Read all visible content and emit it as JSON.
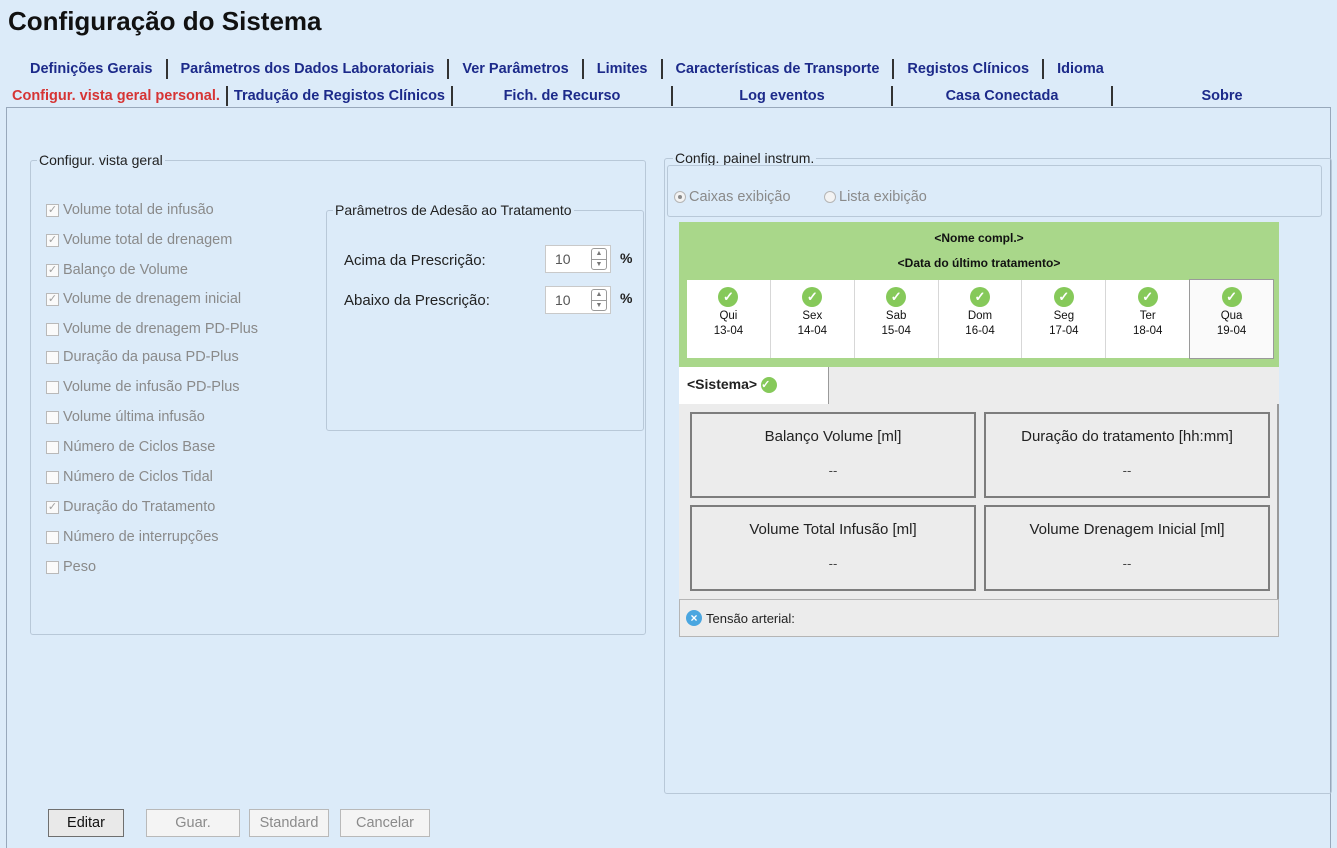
{
  "title": "Configuração do Sistema",
  "tabs_row1": [
    "Definições Gerais",
    "Parâmetros dos Dados Laboratoriais",
    "Ver Parâmetros",
    "Limites",
    "Características de Transporte",
    "Registos Clínicos",
    "Idioma"
  ],
  "tabs_row2": [
    "Configur. vista geral personal.",
    "Tradução de Registos Clínicos",
    "Fich. de Recurso",
    "Log eventos",
    "Casa Conectada",
    "Sobre"
  ],
  "active_tab": "Configur. vista geral personal.",
  "colors": {
    "active_tab": "#d63434",
    "tab_text": "#1c2a8a",
    "background": "#dcebf9",
    "preview_green": "#a9d78a",
    "check_green": "#86c95a"
  },
  "overview": {
    "legend": "Configur. vista geral",
    "items": [
      {
        "label": "Volume total de infusão",
        "checked": true
      },
      {
        "label": "Volume total de drenagem",
        "checked": true
      },
      {
        "label": "Balanço de Volume",
        "checked": true
      },
      {
        "label": "Volume de drenagem inicial",
        "checked": true
      },
      {
        "label": "Volume de drenagem PD-Plus",
        "checked": false
      },
      {
        "label": "Duração da pausa PD-Plus",
        "checked": false
      },
      {
        "label": "Volume de infusão PD-Plus",
        "checked": false
      },
      {
        "label": "Volume última infusão",
        "checked": false
      },
      {
        "label": "Número de Ciclos Base",
        "checked": false
      },
      {
        "label": "Número de Ciclos Tidal",
        "checked": false
      },
      {
        "label": "Duração do Tratamento",
        "checked": true
      },
      {
        "label": "Número de interrupções",
        "checked": false
      },
      {
        "label": "Peso",
        "checked": false
      }
    ]
  },
  "adherence": {
    "legend": "Parâmetros de Adesão ao Tratamento",
    "above_label": "Acima da Prescrição:",
    "above_value": "10",
    "below_label": "Abaixo da Prescrição:",
    "below_value": "10",
    "unit": "%"
  },
  "dashboard": {
    "legend": "Config. painel instrum.",
    "radio_boxes": "Caixas exibição",
    "radio_list": "Lista exibição",
    "selected": "Caixas exibição",
    "name": "<Nome compl.>",
    "last_treatment": "<Data do último tratamento>",
    "days": [
      {
        "day": "Qui",
        "date": "13-04"
      },
      {
        "day": "Sex",
        "date": "14-04"
      },
      {
        "day": "Sab",
        "date": "15-04"
      },
      {
        "day": "Dom",
        "date": "16-04"
      },
      {
        "day": "Seg",
        "date": "17-04"
      },
      {
        "day": "Ter",
        "date": "18-04"
      },
      {
        "day": "Qua",
        "date": "19-04"
      }
    ],
    "system_tab": "<Sistema>",
    "tiles": [
      {
        "title": "Balanço Volume [ml]",
        "value": "--"
      },
      {
        "title": "Duração do tratamento [hh:mm]",
        "value": "--"
      },
      {
        "title": "Volume Total Infusão [ml]",
        "value": "--"
      },
      {
        "title": "Volume Drenagem Inicial [ml]",
        "value": "--"
      }
    ],
    "blood_pressure": "Tensão arterial:"
  },
  "buttons": {
    "edit": "Editar",
    "save": "Guar.",
    "standard": "Standard",
    "cancel": "Cancelar"
  }
}
